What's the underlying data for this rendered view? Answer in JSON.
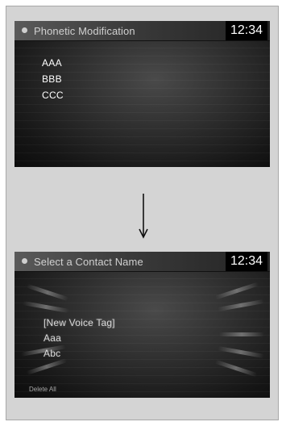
{
  "screens": [
    {
      "title": "Phonetic Modification",
      "clock": "12:34",
      "items": [
        "AAA",
        "BBB",
        "CCC"
      ]
    },
    {
      "title": "Select a Contact Name",
      "clock": "12:34",
      "items": [
        "[New Voice Tag]",
        "Aaa",
        "Abc"
      ],
      "footer_button": "Delete All"
    }
  ],
  "arrow_icon": "down-arrow-icon"
}
